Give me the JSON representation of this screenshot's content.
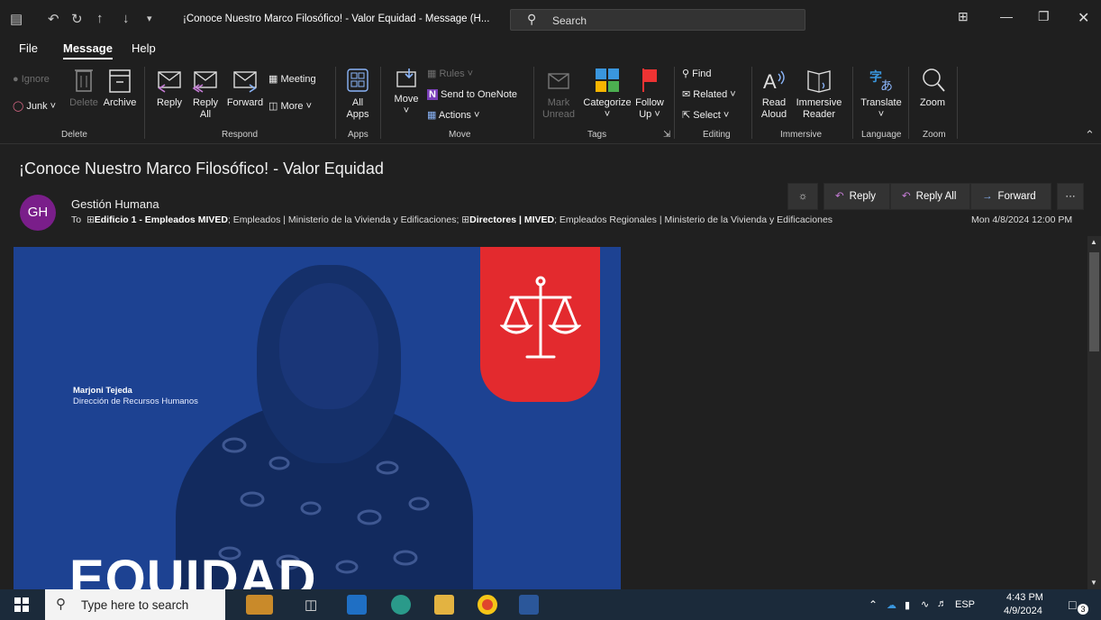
{
  "window": {
    "title": "¡Conoce Nuestro Marco Filosófico! - Valor Equidad  -  Message (H...",
    "search_placeholder": "Search"
  },
  "ribbon": {
    "tabs": [
      "File",
      "Message",
      "Help"
    ],
    "active_tab": "Message",
    "delete": {
      "ignore": "Ignore",
      "junk": "Junk",
      "delete": "Delete",
      "archive": "Archive",
      "group": "Delete"
    },
    "respond": {
      "reply": "Reply",
      "reply_all_1": "Reply",
      "reply_all_2": "All",
      "forward": "Forward",
      "meeting": "Meeting",
      "more": "More",
      "group": "Respond"
    },
    "apps": {
      "all_apps_1": "All",
      "all_apps_2": "Apps",
      "group": "Apps"
    },
    "move": {
      "move": "Move",
      "rules": "Rules",
      "onenote": "Send to OneNote",
      "actions": "Actions",
      "group": "Move"
    },
    "tags": {
      "mark_unread_1": "Mark",
      "mark_unread_2": "Unread",
      "categorize": "Categorize",
      "follow_up_1": "Follow",
      "follow_up_2": "Up",
      "group": "Tags"
    },
    "editing": {
      "find": "Find",
      "related": "Related",
      "select": "Select",
      "group": "Editing"
    },
    "immersive": {
      "read_aloud_1": "Read",
      "read_aloud_2": "Aloud",
      "immersive_reader_1": "Immersive",
      "immersive_reader_2": "Reader",
      "group": "Immersive"
    },
    "language": {
      "translate": "Translate",
      "group": "Language"
    },
    "zoom": {
      "zoom": "Zoom",
      "group": "Zoom"
    }
  },
  "message": {
    "subject": "¡Conoce Nuestro Marco Filosófico! - Valor Equidad",
    "avatar_initials": "GH",
    "sender": "Gestión Humana",
    "to_label": "To",
    "recipient_1": "Edificio 1 - Empleados MIVED",
    "recipient_2": "; Empleados | Ministerio de la Vivienda y Edificaciones; ",
    "recipient_3": "Directores | MIVED",
    "recipient_4": "; Empleados Regionales | Ministerio de la Vivienda y Edificaciones",
    "date": "Mon 4/8/2024 12:00 PM",
    "actions": {
      "reply": "Reply",
      "reply_all": "Reply All",
      "forward": "Forward",
      "more": "···"
    }
  },
  "body_image": {
    "person_name": "Marjoni Tejeda",
    "person_dept": "Dirección de Recursos Humanos",
    "headline": "EQUIDAD",
    "colors": {
      "background": "#1d4292",
      "accent": "#e32a2e"
    }
  },
  "taskbar": {
    "search_placeholder": "Type here to search",
    "language": "ESP",
    "time": "4:43 PM",
    "date": "4/9/2024",
    "notifications": "3"
  }
}
